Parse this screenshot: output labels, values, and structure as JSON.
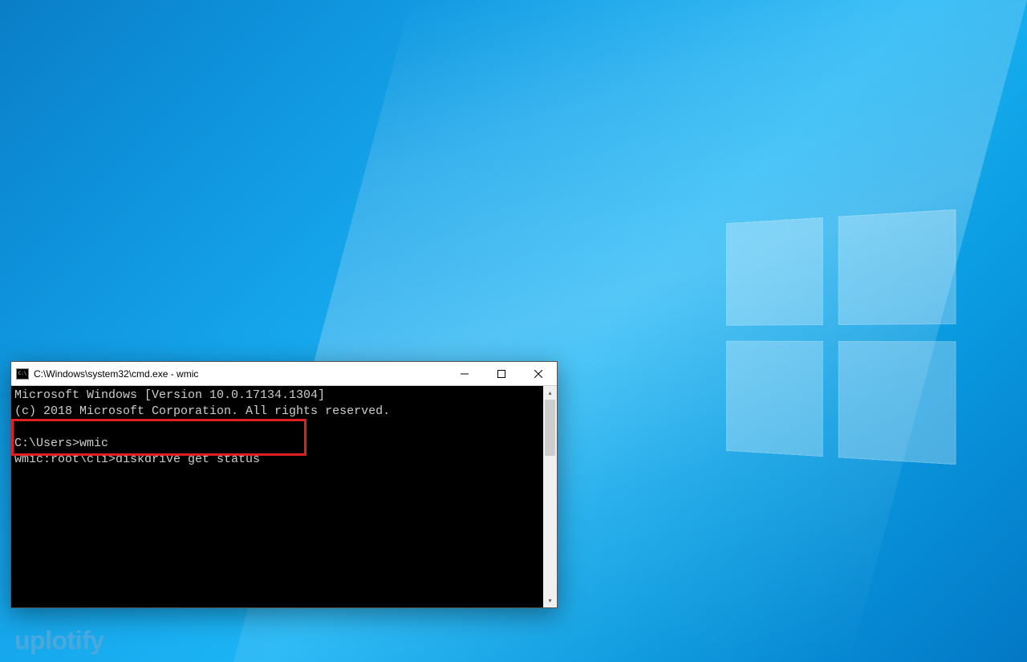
{
  "window": {
    "title": "C:\\Windows\\system32\\cmd.exe - wmic",
    "icon_name": "cmd-icon"
  },
  "terminal": {
    "line1": "Microsoft Windows [Version 10.0.17134.1304]",
    "line2": "(c) 2018 Microsoft Corporation. All rights reserved.",
    "blank": "",
    "prompt1": "C:\\Users>wmic",
    "prompt2": "wmic:root\\cli>diskdrive get status"
  },
  "highlight": {
    "color": "#e02020"
  },
  "watermark": {
    "text": "uplotify"
  }
}
